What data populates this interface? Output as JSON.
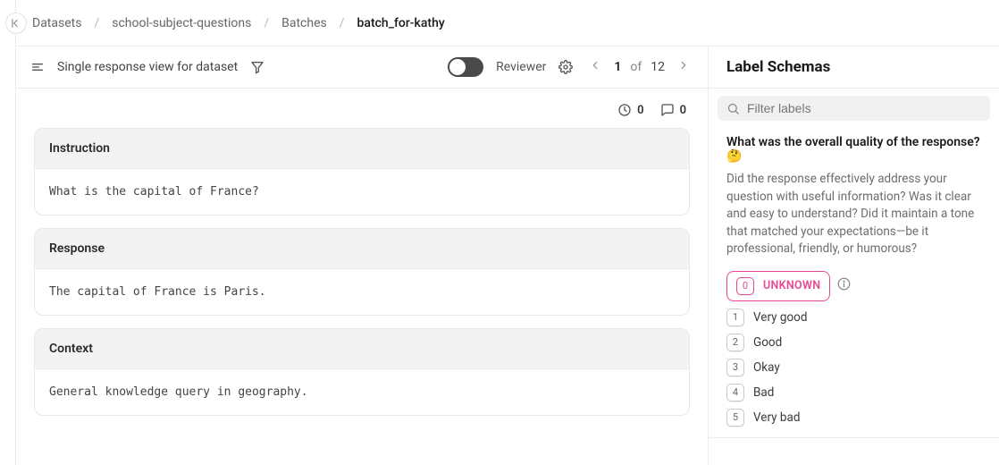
{
  "breadcrumb": {
    "items": [
      {
        "label": "Datasets"
      },
      {
        "label": "school-subject-questions"
      },
      {
        "label": "Batches"
      }
    ],
    "current": "batch_for-kathy"
  },
  "breadcrumb_labels": {
    "datasets": "Datasets",
    "dataset_name": "school-subject-questions",
    "batches": "Batches",
    "current": "batch_for-kathy"
  },
  "toolbar": {
    "view_label": "Single response view for dataset",
    "reviewer_label": "Reviewer",
    "page_current": "1",
    "page_of": "of",
    "page_total": "12"
  },
  "meta": {
    "time_count": "0",
    "comment_count": "0"
  },
  "cards": {
    "instruction": {
      "title": "Instruction",
      "body": "What is the capital of France?"
    },
    "response": {
      "title": "Response",
      "body": "The capital of France is Paris."
    },
    "context": {
      "title": "Context",
      "body": "General knowledge query in geography."
    }
  },
  "side": {
    "title": "Label Schemas",
    "filter_placeholder": "Filter labels",
    "question_title": "What was the overall quality of the response? 🤔",
    "question_desc": "Did the response effectively address your question with useful information? Was it clear and easy to understand? Did it maintain a tone that matched your expectations—be it professional, friendly, or humorous?",
    "options": [
      {
        "key": "0",
        "label": "UNKNOWN",
        "selected": true
      },
      {
        "key": "1",
        "label": "Very good"
      },
      {
        "key": "2",
        "label": "Good"
      },
      {
        "key": "3",
        "label": "Okay"
      },
      {
        "key": "4",
        "label": "Bad"
      },
      {
        "key": "5",
        "label": "Very bad"
      }
    ]
  }
}
